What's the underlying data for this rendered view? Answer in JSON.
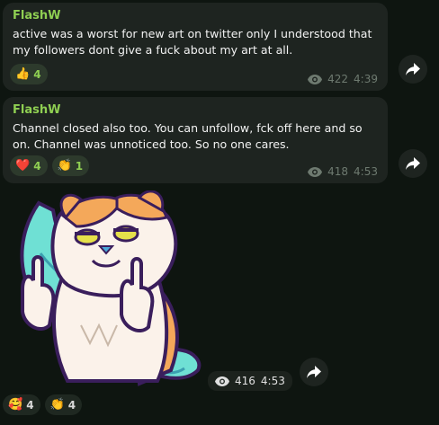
{
  "messages": [
    {
      "sender": "FlashW",
      "text": "active was a worst for new art on twitter only I understood that my followers dont give a fuck about my art at all.",
      "reactions": [
        {
          "emoji": "👍",
          "count": "4"
        }
      ],
      "views": "422",
      "time": "4:39"
    },
    {
      "sender": "FlashW",
      "text": "Channel closed also too. You can unfollow, fck off here and so on. Channel was unnoticed too. So no one cares.",
      "reactions": [
        {
          "emoji": "❤️",
          "count": "4"
        },
        {
          "emoji": "👏",
          "count": "1"
        }
      ],
      "views": "418",
      "time": "4:53"
    },
    {
      "sticker": "middle-finger-furry-sticker",
      "reactions": [
        {
          "emoji": "🥰",
          "count": "4"
        },
        {
          "emoji": "👏",
          "count": "4"
        }
      ],
      "views": "416",
      "time": "4:53"
    }
  ],
  "colors": {
    "background": "#0e1510",
    "bubble": "#1e2420",
    "sender": "#8fcf52",
    "meta": "#6e7a70"
  },
  "icons": [
    "eye-icon",
    "share-arrow-icon"
  ]
}
